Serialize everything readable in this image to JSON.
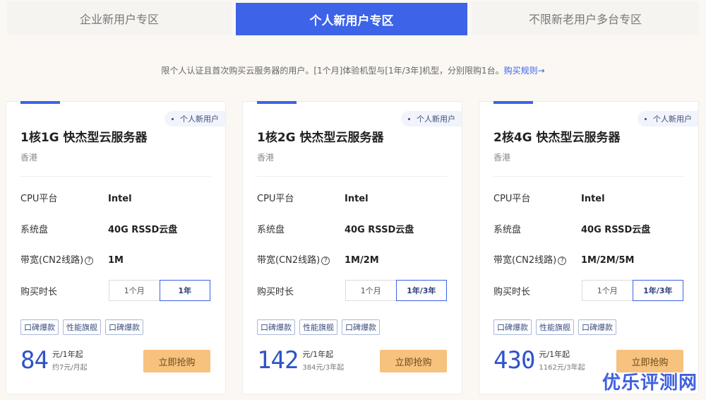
{
  "tabs": [
    {
      "label": "企业新用户专区"
    },
    {
      "label": "个人新用户专区"
    },
    {
      "label": "不限新老用户多台专区"
    }
  ],
  "notice": {
    "text": "限个人认证且首次购买云服务器的用户。[1个月]体验机型与[1年/3年]机型，分别限购1台。",
    "link": "购买规则→"
  },
  "cards": [
    {
      "badge": "个人新用户",
      "title": "1核1G 快杰型云服务器",
      "region": "香港",
      "cpu_label": "CPU平台",
      "cpu_value": "Intel",
      "disk_label": "系统盘",
      "disk_value": "40G RSSD云盘",
      "bw_label": "带宽(CN2线路)",
      "bw_value": "1M",
      "duration_label": "购买时长",
      "opt1": "1个月",
      "opt2": "1年",
      "tags": [
        "口碑爆款",
        "性能旗舰",
        "口碑爆款"
      ],
      "price": "84",
      "price_unit": "元/1年起",
      "price_sub": "约7元/月起",
      "buy": "立即抢购"
    },
    {
      "badge": "个人新用户",
      "title": "1核2G 快杰型云服务器",
      "region": "香港",
      "cpu_label": "CPU平台",
      "cpu_value": "Intel",
      "disk_label": "系统盘",
      "disk_value": "40G RSSD云盘",
      "bw_label": "带宽(CN2线路)",
      "bw_value": "1M/2M",
      "duration_label": "购买时长",
      "opt1": "1个月",
      "opt2": "1年/3年",
      "tags": [
        "口碑爆款",
        "性能旗舰",
        "口碑爆款"
      ],
      "price": "142",
      "price_unit": "元/1年起",
      "price_sub": "384元/3年起",
      "buy": "立即抢购"
    },
    {
      "badge": "个人新用户",
      "title": "2核4G 快杰型云服务器",
      "region": "香港",
      "cpu_label": "CPU平台",
      "cpu_value": "Intel",
      "disk_label": "系统盘",
      "disk_value": "40G RSSD云盘",
      "bw_label": "带宽(CN2线路)",
      "bw_value": "1M/2M/5M",
      "duration_label": "购买时长",
      "opt1": "1个月",
      "opt2": "1年/3年",
      "tags": [
        "口碑爆款",
        "性能旗舰",
        "口碑爆款"
      ],
      "price": "430",
      "price_unit": "元/1年起",
      "price_sub": "1162元/3年起",
      "buy": "立即抢购"
    }
  ],
  "watermark": "优乐评测网",
  "colors": {
    "accent": "#3c63e8",
    "buy_button": "#f6c27e",
    "price": "#2f54c8"
  }
}
